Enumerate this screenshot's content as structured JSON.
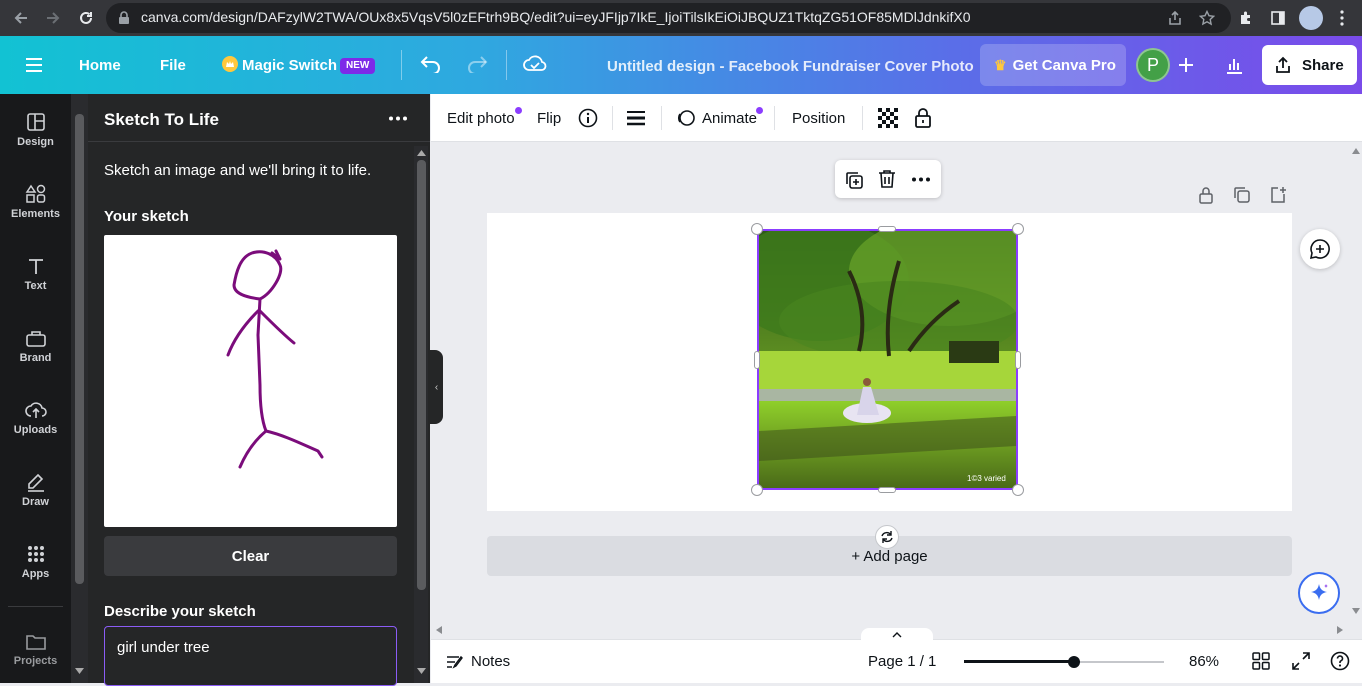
{
  "browser": {
    "url": "canva.com/design/DAFzylW2TWA/OUx8x5VqsV5l0zEFtrh9BQ/edit?ui=eyJFIjp7IkE_IjoiTilsIkEiOiJBQUZ1TktqZG51OF85MDlJdnkifX0"
  },
  "topbar": {
    "home": "Home",
    "file": "File",
    "magic_switch": "Magic Switch",
    "new_badge": "NEW",
    "title": "Untitled design - Facebook Fundraiser Cover Photo",
    "get_pro": "Get Canva Pro",
    "avatar_initial": "P",
    "share": "Share"
  },
  "leftnav": {
    "items": [
      {
        "label": "Design",
        "icon": "design-icon"
      },
      {
        "label": "Elements",
        "icon": "elements-icon"
      },
      {
        "label": "Text",
        "icon": "text-icon"
      },
      {
        "label": "Brand",
        "icon": "brand-icon"
      },
      {
        "label": "Uploads",
        "icon": "uploads-icon"
      },
      {
        "label": "Draw",
        "icon": "draw-icon"
      },
      {
        "label": "Apps",
        "icon": "apps-icon"
      },
      {
        "label": "Projects",
        "icon": "projects-icon"
      }
    ]
  },
  "panel": {
    "title": "Sketch To Life",
    "intro": "Sketch an image and we'll bring it to life.",
    "your_sketch": "Your sketch",
    "clear": "Clear",
    "describe_label": "Describe your sketch",
    "describe_value": "girl under tree",
    "sketch_color": "#7b0c7b"
  },
  "toolbar": {
    "edit_photo": "Edit photo",
    "flip": "Flip",
    "animate": "Animate",
    "position": "Position"
  },
  "canvas": {
    "add_page": "+ Add page",
    "watermark": "1©3 varied"
  },
  "footer": {
    "notes": "Notes",
    "page_indicator": "Page 1 / 1",
    "zoom": "86%",
    "zoom_fraction": 0.55
  },
  "colors": {
    "accent": "#8b3dff",
    "panel_bg": "#252627",
    "nav_bg": "#18191b"
  }
}
